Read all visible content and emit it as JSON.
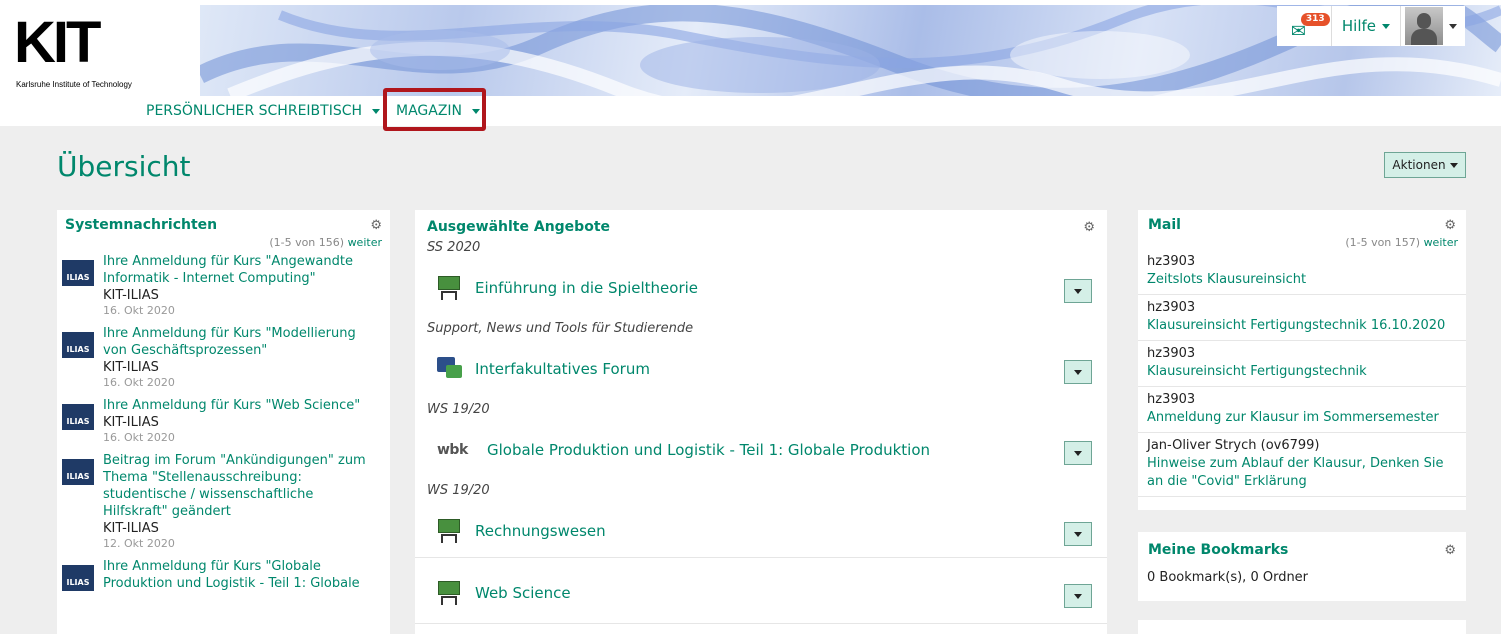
{
  "header": {
    "logo_text": "KIT",
    "logo_subtitle": "Karlsruhe Institute of Technology",
    "mail_count": "313",
    "help_label": "Hilfe"
  },
  "mainmenu": {
    "desk": "PERSÖNLICHER SCHREIBTISCH",
    "magazin": "MAGAZIN"
  },
  "page": {
    "title": "Übersicht",
    "actions_label": "Aktionen"
  },
  "system_messages": {
    "title": "Systemnachrichten",
    "pager": "(1-5 von 156)",
    "pager_link": "weiter",
    "items": [
      {
        "title": "Ihre Anmeldung für Kurs \"Angewandte Informatik - Internet Computing\"",
        "source": "KIT-ILIAS",
        "date": "16. Okt 2020"
      },
      {
        "title": "Ihre Anmeldung für Kurs \"Modellierung von Geschäftsprozessen\"",
        "source": "KIT-ILIAS",
        "date": "16. Okt 2020"
      },
      {
        "title": "Ihre Anmeldung für Kurs \"Web Science\"",
        "source": "KIT-ILIAS",
        "date": "16. Okt 2020"
      },
      {
        "title": "Beitrag im Forum \"Ankündigungen\" zum Thema \"Stellenausschreibung: studentische / wissenschaftliche Hilfskraft\" geändert",
        "source": "KIT-ILIAS",
        "date": "12. Okt 2020"
      },
      {
        "title": "Ihre Anmeldung für Kurs \"Globale Produktion und Logistik - Teil 1: Globale",
        "source": "",
        "date": ""
      }
    ]
  },
  "offers": {
    "title": "Ausgewählte Angebote",
    "groups": [
      {
        "label": "SS 2020",
        "title": "Einführung in die Spieltheorie",
        "icon": "course-board-icon"
      },
      {
        "label": "Support, News und Tools für Studierende",
        "title": "Interfakultatives Forum",
        "icon": "forum-icon"
      },
      {
        "label": "WS 19/20",
        "title": "Globale Produktion und Logistik - Teil 1: Globale Produktion",
        "icon": "wbk-logo-icon",
        "icon_text": "wbk"
      },
      {
        "label": "WS 19/20",
        "title": "Rechnungswesen",
        "icon": "course-board-icon"
      },
      {
        "label": "",
        "title": "Web Science",
        "icon": "course-board-icon"
      }
    ]
  },
  "mail": {
    "title": "Mail",
    "pager": "(1-5 von 157)",
    "pager_link": "weiter",
    "items": [
      {
        "from": "hz3903",
        "subject": "Zeitslots Klausureinsicht"
      },
      {
        "from": "hz3903",
        "subject": "Klausureinsicht Fertigungstechnik 16.10.2020"
      },
      {
        "from": "hz3903",
        "subject": "Klausureinsicht Fertigungstechnik"
      },
      {
        "from": "hz3903",
        "subject": "Anmeldung zur Klausur im Sommersemester"
      },
      {
        "from": "Jan-Oliver Strych (ov6799)",
        "subject": "Hinweise zum Ablauf der Klausur, Denken Sie an die \"Covid\" Erklärung"
      }
    ]
  },
  "bookmarks": {
    "title": "Meine Bookmarks",
    "summary": "0 Bookmark(s), 0 Ordner"
  },
  "colors": {
    "accent": "#00876c",
    "highlight_box": "#b0161c",
    "badge": "#e6512a"
  }
}
